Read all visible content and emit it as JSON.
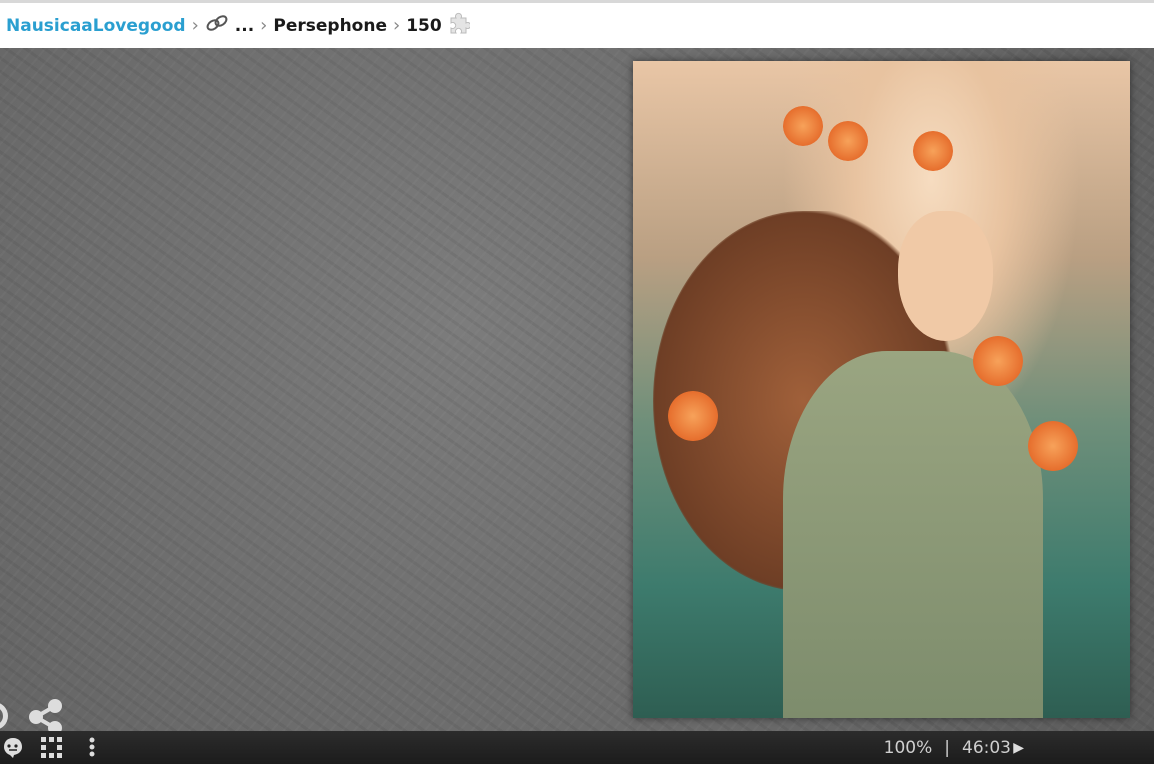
{
  "breadcrumb": {
    "user": "NausicaaLovegood",
    "ellipsis": "...",
    "album": "Persephone",
    "pieces": "150"
  },
  "image": {
    "title": "Persephone"
  },
  "status": {
    "zoom": "100%",
    "divider": "|",
    "timer": "46:03"
  }
}
